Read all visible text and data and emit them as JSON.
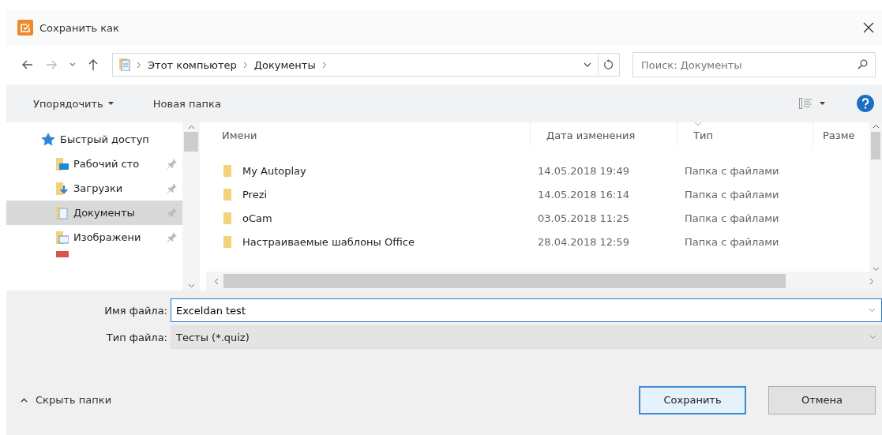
{
  "window": {
    "title": "Сохранить как"
  },
  "address": {
    "crumbs": [
      "Этот компьютер",
      "Документы"
    ],
    "search_placeholder": "Поиск: Документы"
  },
  "toolbar": {
    "organize": "Упорядочить",
    "new_folder": "Новая папка"
  },
  "sidebar": {
    "items": [
      {
        "label": "Быстрый доступ",
        "kind": "star",
        "pinned": false,
        "selected": false
      },
      {
        "label": "Рабочий сто",
        "kind": "desktop",
        "pinned": true,
        "selected": false
      },
      {
        "label": "Загрузки",
        "kind": "downloads",
        "pinned": true,
        "selected": false
      },
      {
        "label": "Документы",
        "kind": "documents",
        "pinned": true,
        "selected": true
      },
      {
        "label": "Изображени",
        "kind": "pictures",
        "pinned": true,
        "selected": false
      }
    ]
  },
  "table": {
    "columns": [
      "Имени",
      "Дата изменения",
      "Тип",
      "Разме"
    ],
    "rows": [
      {
        "name": "My Autoplay",
        "date": "14.05.2018 19:49",
        "type": "Папка с файлами"
      },
      {
        "name": "Prezi",
        "date": "14.05.2018 16:14",
        "type": "Папка с файлами"
      },
      {
        "name": "oCam",
        "date": "03.05.2018 11:25",
        "type": "Папка с файлами"
      },
      {
        "name": "Настраиваемые шаблоны Office",
        "date": "28.04.2018 12:59",
        "type": "Папка с файлами"
      }
    ]
  },
  "form": {
    "file_name_label": "Имя файла:",
    "file_name": "Exceldan test",
    "file_type_label": "Тип файла:",
    "file_type": "Тесты (*.quiz)"
  },
  "footer": {
    "hide_folders": "Скрыть папки",
    "save": "Сохранить",
    "cancel": "Отмена"
  }
}
